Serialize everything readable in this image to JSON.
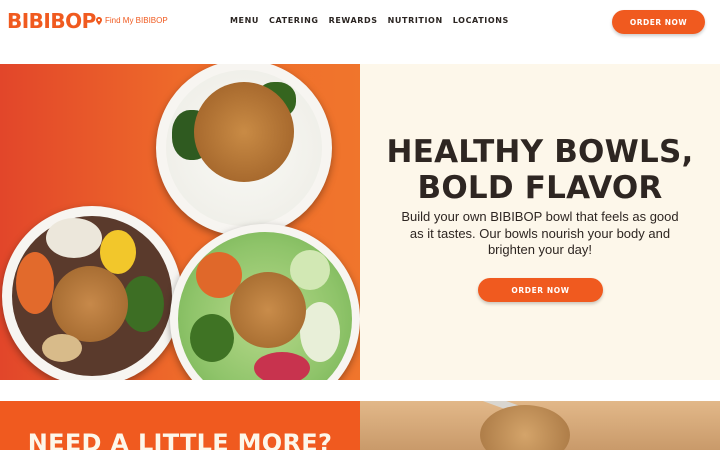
{
  "header": {
    "logo": "BIBIBOP",
    "find_link": "Find My BIBIBOP",
    "nav": [
      "MENU",
      "CATERING",
      "REWARDS",
      "NUTRITION",
      "LOCATIONS"
    ],
    "order_button": "ORDER NOW"
  },
  "hero": {
    "headline_line1": "HEALTHY BOWLS,",
    "headline_line2": "BOLD FLAVOR",
    "subtext": "Build your own BIBIBOP bowl that feels as good as it tastes. Our bowls nourish your body and brighten your day!",
    "order_button": "ORDER NOW"
  },
  "promo": {
    "heading": "NEED A LITTLE MORE?"
  },
  "colors": {
    "brand_orange": "#f05a1f",
    "cream": "#fdf7ea",
    "dark_text": "#2e2622"
  }
}
